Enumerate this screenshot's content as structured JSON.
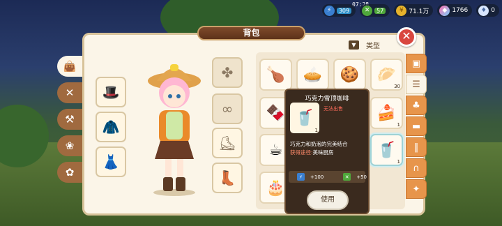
{
  "top": {
    "clock": "07:28",
    "battery": "309",
    "energy": "57",
    "coins": "71.1万",
    "gems": "1766",
    "diamonds": "0"
  },
  "panel": {
    "title": "背包",
    "close_icon": "close-icon"
  },
  "left_tabs": [
    {
      "icon": "bag-icon",
      "active": true
    },
    {
      "icon": "tools-icon",
      "active": false
    },
    {
      "icon": "farm-icon",
      "active": false
    },
    {
      "icon": "pet-icon",
      "active": false
    },
    {
      "icon": "candy-icon",
      "active": false
    }
  ],
  "sort": {
    "label": "类型"
  },
  "grid": [
    {
      "icon": "roast-chicken-icon",
      "count": ""
    },
    {
      "icon": "pie-icon",
      "count": ""
    },
    {
      "icon": "gingerbread-icon",
      "count": ""
    },
    {
      "icon": "dumplings-icon",
      "count": "30"
    },
    {
      "icon": "chocolate-pie-icon",
      "count": ""
    },
    {
      "icon": "empty",
      "count": ""
    },
    {
      "icon": "empty",
      "count": ""
    },
    {
      "icon": "cookie-pie-icon",
      "count": "1"
    },
    {
      "icon": "latte-icon",
      "count": ""
    },
    {
      "icon": "empty",
      "count": ""
    },
    {
      "icon": "empty",
      "count": ""
    },
    {
      "icon": "mocha-icon",
      "count": "1"
    },
    {
      "icon": "cake-icon",
      "count": ""
    }
  ],
  "right_tabs": [
    "box-icon",
    "burger-icon",
    "shirt-icon",
    "sofa-icon",
    "fence-icon",
    "seed-icon",
    "badge-icon"
  ],
  "tooltip": {
    "title": "巧克力雪顶咖啡",
    "count": "1",
    "no_sale": "无法出售",
    "desc": "巧克力和奶泡的完美结合",
    "source_label": "获得途径:",
    "source_value": "美味厨房",
    "stat1": "+100",
    "stat2": "+50",
    "use_button": "使用"
  }
}
